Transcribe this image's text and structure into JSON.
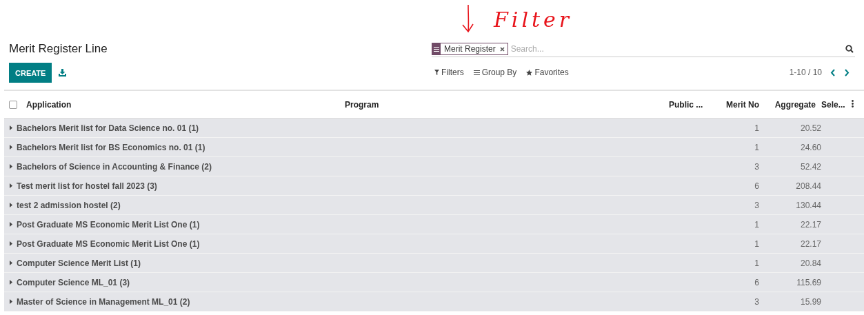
{
  "annotation": {
    "text": "Filter"
  },
  "title": "Merit Register Line",
  "create_button": "CREATE",
  "search": {
    "facet": "Merit Register",
    "placeholder": "Search..."
  },
  "search_options": [
    "Filters",
    "Group By",
    "Favorites"
  ],
  "pager": "1-10 / 10",
  "table": {
    "select_all": {
      "checked": false
    },
    "columns": [
      "Application",
      "Program",
      "Public ...",
      "Merit No",
      "Aggregate",
      "Sele..."
    ],
    "rows": [
      {
        "group": "Bachelors Merit list for Data Science no. 01 (1)",
        "merit_no": "1",
        "aggregate": "20.52"
      },
      {
        "group": "Bachelors Merit list for BS Economics no. 01 (1)",
        "merit_no": "1",
        "aggregate": "24.60"
      },
      {
        "group": "Bachelors of Science in Accounting & Finance (2)",
        "merit_no": "3",
        "aggregate": "52.42"
      },
      {
        "group": "Test merit list for hostel fall 2023 (3)",
        "merit_no": "6",
        "aggregate": "208.44"
      },
      {
        "group": "test 2 admission hostel (2)",
        "merit_no": "3",
        "aggregate": "130.44"
      },
      {
        "group": "Post Graduate MS Economic Merit List One (1)",
        "merit_no": "1",
        "aggregate": "22.17"
      },
      {
        "group": "Post Graduate MS Economic Merit List One (1)",
        "merit_no": "1",
        "aggregate": "22.17"
      },
      {
        "group": "Computer Science Merit List (1)",
        "merit_no": "1",
        "aggregate": "20.84"
      },
      {
        "group": "Computer Science ML_01 (3)",
        "merit_no": "6",
        "aggregate": "115.69"
      },
      {
        "group": "Master of Science in Management ML_01 (2)",
        "merit_no": "3",
        "aggregate": "15.99"
      }
    ]
  }
}
